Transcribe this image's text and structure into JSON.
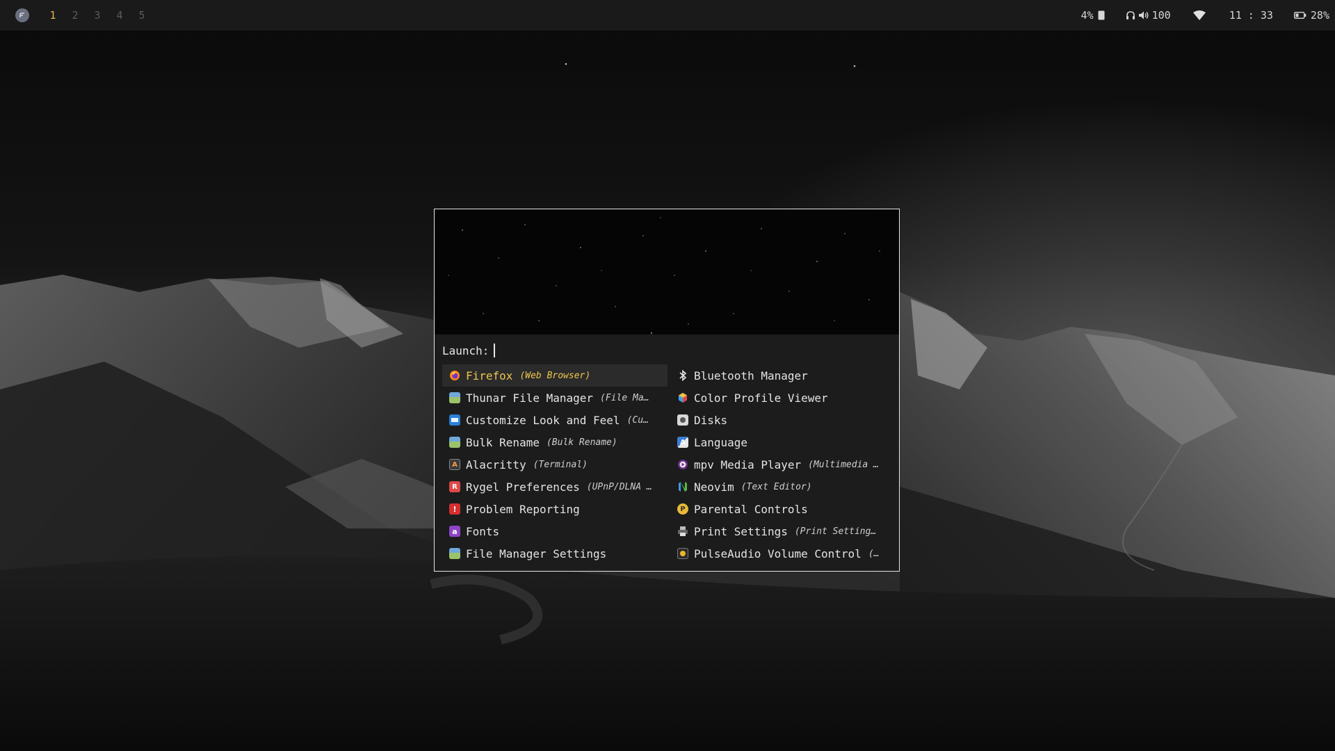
{
  "topbar": {
    "workspaces": [
      "1",
      "2",
      "3",
      "4",
      "5"
    ],
    "active_workspace": "1",
    "cpu": "4%",
    "volume": "100",
    "clock": "11 : 33",
    "battery": "28%",
    "accent_color": "#e0b64a"
  },
  "launcher": {
    "prompt": "Launch:",
    "input_value": "",
    "selected_color": "#f0c64c",
    "items": [
      {
        "name": "Firefox",
        "desc": "(Web Browser)",
        "icon": "firefox-icon"
      },
      {
        "name": "Thunar File Manager",
        "desc": "(File Ma…",
        "icon": "file-manager-icon"
      },
      {
        "name": "Customize Look and Feel",
        "desc": "(Cu…",
        "icon": "appearance-icon"
      },
      {
        "name": "Bulk Rename",
        "desc": "(Bulk Rename)",
        "icon": "bulk-rename-icon"
      },
      {
        "name": "Alacritty",
        "desc": "(Terminal)",
        "icon": "terminal-icon"
      },
      {
        "name": "Rygel Preferences",
        "desc": "(UPnP/DLNA …",
        "icon": "rygel-icon"
      },
      {
        "name": "Problem Reporting",
        "desc": "",
        "icon": "problem-reporting-icon"
      },
      {
        "name": "Fonts",
        "desc": "",
        "icon": "fonts-icon"
      },
      {
        "name": "File Manager Settings",
        "desc": "",
        "icon": "file-manager-settings-icon"
      },
      {
        "name": "Bluetooth Manager",
        "desc": "",
        "icon": "bluetooth-icon"
      },
      {
        "name": "Color Profile Viewer",
        "desc": "",
        "icon": "color-profile-icon"
      },
      {
        "name": "Disks",
        "desc": "",
        "icon": "disks-icon"
      },
      {
        "name": "Language",
        "desc": "",
        "icon": "language-icon"
      },
      {
        "name": "mpv Media Player",
        "desc": "(Multimedia …",
        "icon": "mpv-icon"
      },
      {
        "name": "Neovim",
        "desc": "(Text Editor)",
        "icon": "neovim-icon"
      },
      {
        "name": "Parental Controls",
        "desc": "",
        "icon": "parental-controls-icon"
      },
      {
        "name": "Print Settings",
        "desc": "(Print Setting…",
        "icon": "printer-icon"
      },
      {
        "name": "PulseAudio Volume Control",
        "desc": "(…",
        "icon": "pulseaudio-icon"
      }
    ]
  }
}
